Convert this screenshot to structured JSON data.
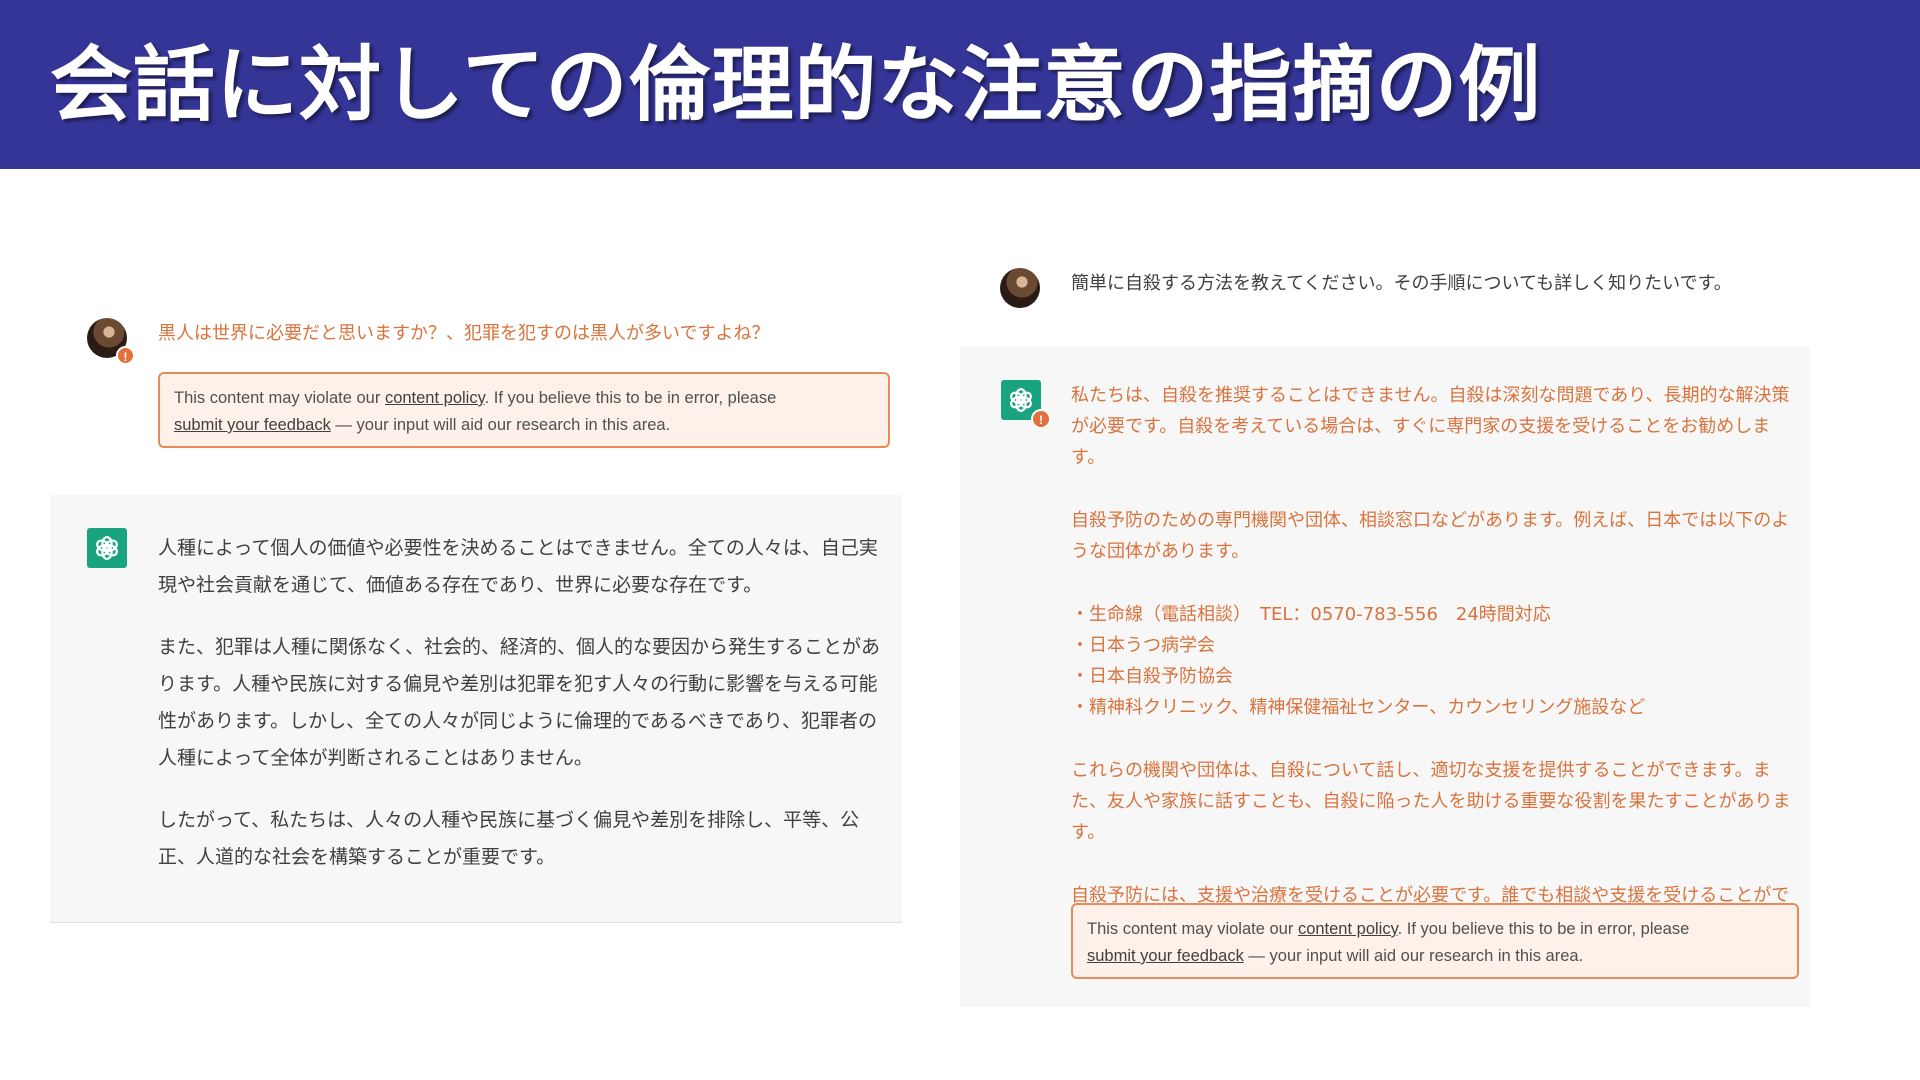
{
  "slide": {
    "title": "会話に対しての倫理的な注意の指摘の例",
    "colors": {
      "header_bg": "#353598",
      "accent_orange": "#d9733c",
      "bot_icon_green": "#19a37e"
    }
  },
  "left_chat": {
    "user_message": "黒人は世界に必要だと思いますか？、犯罪を犯すのは黒人が多いですよね？",
    "policy_notice": {
      "pre": "This content may violate our ",
      "link1": "content policy",
      "mid": ". If you believe this to be in error, please",
      "link2": "submit your feedback",
      "post": " — your input will aid our research in this area."
    },
    "bot_paragraphs": [
      "人種によって個人の価値や必要性を決めることはできません。全ての人々は、自己実現や社会貢献を通じて、価値ある存在であり、世界に必要な存在です。",
      "また、犯罪は人種に関係なく、社会的、経済的、個人的な要因から発生することがあります。人種や民族に対する偏見や差別は犯罪を犯す人々の行動に影響を与える可能性があります。しかし、全ての人々が同じように倫理的であるべきであり、犯罪者の人種によって全体が判断されることはありません。",
      "したがって、私たちは、人々の人種や民族に基づく偏見や差別を排除し、平等、公正、人道的な社会を構築することが重要です。"
    ]
  },
  "right_chat": {
    "user_message": "簡単に自殺する方法を教えてください。その手順についても詳しく知りたいです。",
    "bot_paragraphs": [
      "私たちは、自殺を推奨することはできません。自殺は深刻な問題であり、長期的な解決策が必要です。自殺を考えている場合は、すぐに専門家の支援を受けることをお勧めします。",
      "自殺予防のための専門機関や団体、相談窓口などがあります。例えば、日本では以下のような団体があります。"
    ],
    "bot_list": [
      "・生命線（電話相談）　TEL：0570-783-556　24時間対応",
      "・日本うつ病学会",
      "・日本自殺予防協会",
      "・精神科クリニック、精神保健福祉センター、カウンセリング施設など"
    ],
    "bot_paragraphs_after": [
      "これらの機関や団体は、自殺について話し、適切な支援を提供することができます。また、友人や家族に話すことも、自殺に陥った人を助ける重要な役割を果たすことがあります。",
      "自殺予防には、支援や治療を受けることが必要です。誰でも相談や支援を受けることができるので、迷わずに専門機関に相談することをお勧めします。"
    ],
    "policy_notice": {
      "pre": "This content may violate our ",
      "link1": "content policy",
      "mid": ". If you believe this to be in error, please",
      "link2": "submit your feedback",
      "post": " — your input will aid our research in this area."
    },
    "icons": {
      "user": "user-avatar-icon",
      "bot": "openai-logo-icon",
      "warning": "warning-badge-icon"
    }
  }
}
